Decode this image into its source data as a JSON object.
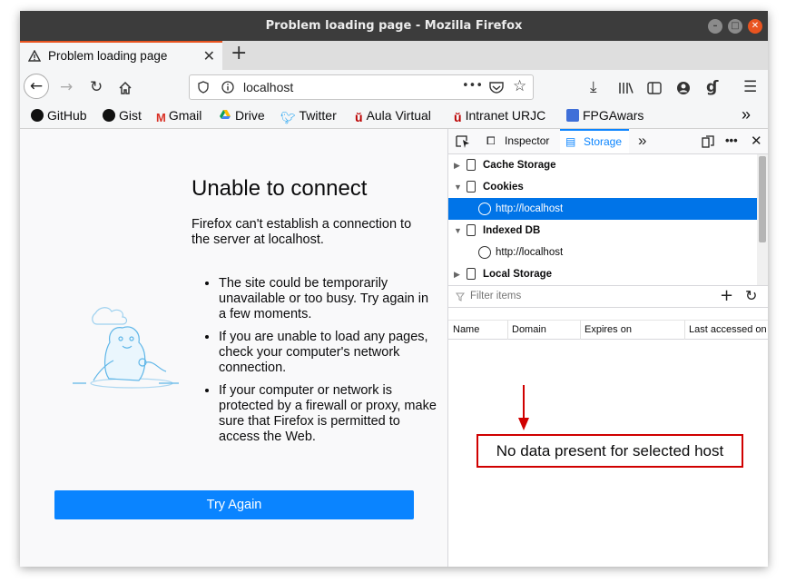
{
  "window": {
    "title": "Problem loading page - Mozilla Firefox"
  },
  "tab": {
    "title": "Problem loading page",
    "close": "✕",
    "new_tab": "+"
  },
  "navbar": {
    "url": "localhost",
    "page_actions": "•••"
  },
  "bookmarks": [
    {
      "label": "GitHub"
    },
    {
      "label": "Gist"
    },
    {
      "label": "Gmail"
    },
    {
      "label": "Drive"
    },
    {
      "label": "Twitter"
    },
    {
      "label": "Aula Virtual"
    },
    {
      "label": "Intranet URJC"
    },
    {
      "label": "FPGAwars"
    }
  ],
  "bookmarks_overflow": "»",
  "error": {
    "title": "Unable to connect",
    "description": "Firefox can't establish a connection to the server at localhost.",
    "items": [
      "The site could be temporarily unavailable or too busy. Try again in a few moments.",
      "If you are unable to load any pages, check your computer's network connection.",
      "If your computer or network is protected by a firewall or proxy, make sure that Firefox is permitted to access the Web."
    ],
    "button": "Try Again"
  },
  "devtools": {
    "tabs": {
      "inspector": "Inspector",
      "storage": "Storage"
    },
    "tree": {
      "cache_storage": "Cache Storage",
      "cookies": "Cookies",
      "cookies_host": "http://localhost",
      "indexed_db": "Indexed DB",
      "indexed_db_host": "http://localhost",
      "local_storage": "Local Storage"
    },
    "filter_placeholder": "Filter items",
    "columns": [
      "Name",
      "Domain",
      "Expires on",
      "Last accessed on"
    ],
    "empty_message": "No data present for selected host"
  },
  "colors": {
    "accent": "#0a84ff",
    "selection": "#0074e8",
    "annotation": "#d00000",
    "tab_indicator": "#e95420"
  }
}
